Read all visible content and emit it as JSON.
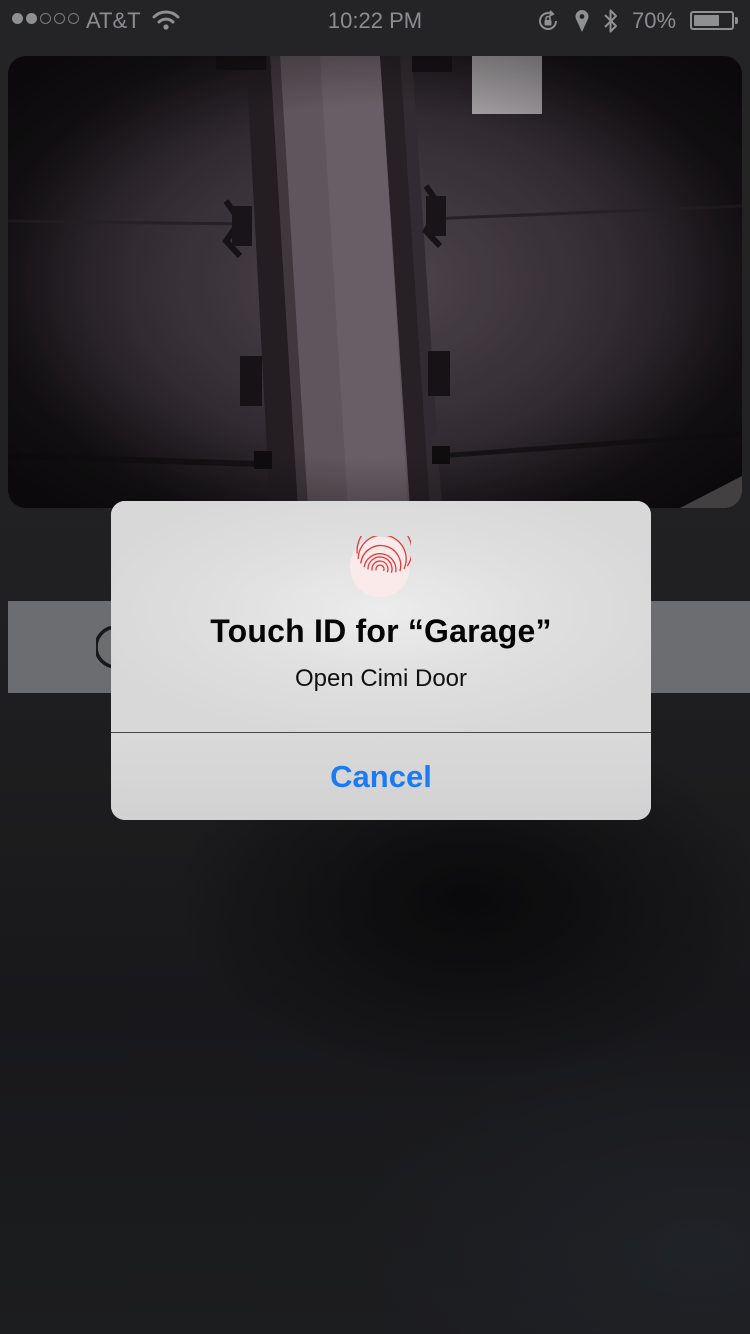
{
  "status_bar": {
    "signal_dots_filled": 2,
    "signal_dots_total": 5,
    "carrier": "AT&T",
    "time": "10:22 PM",
    "battery_percent_label": "70%",
    "battery_level": 0.7,
    "icons": [
      "wifi-icon",
      "rotation-lock-icon",
      "location-icon",
      "bluetooth-icon",
      "battery-icon"
    ]
  },
  "camera_feed": {
    "subject": "garage-door-camera-image"
  },
  "alert": {
    "icon": "fingerprint-icon",
    "icon_color": "#e03c3c",
    "title": "Touch ID for “Garage”",
    "message": "Open Cimi Door",
    "cancel_label": "Cancel",
    "cancel_color": "#1a7cf4"
  }
}
